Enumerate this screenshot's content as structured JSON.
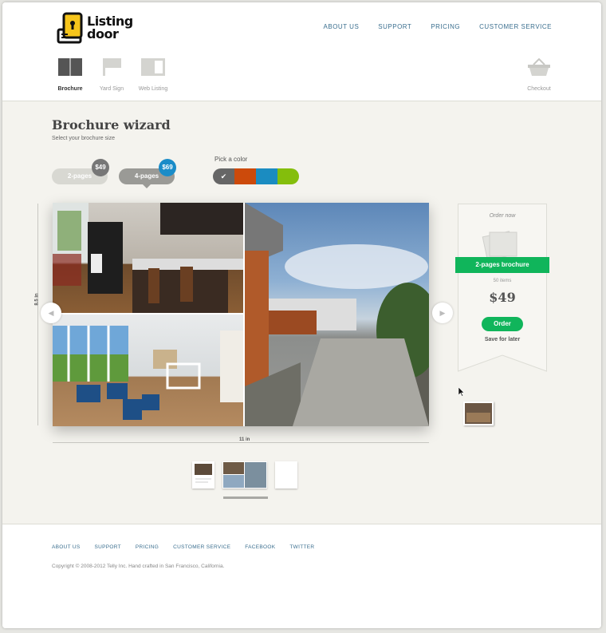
{
  "brand": {
    "name_line1": "Listing",
    "name_line2": "door"
  },
  "topnav": [
    "ABOUT US",
    "SUPPORT",
    "PRICING",
    "CUSTOMER SERVICE"
  ],
  "tools": [
    {
      "label": "Brochure",
      "active": true
    },
    {
      "label": "Yard Sign",
      "active": false
    },
    {
      "label": "Web Listing",
      "active": false
    }
  ],
  "checkout": {
    "label": "Checkout"
  },
  "wizard": {
    "title": "Brochure wizard",
    "subtitle": "Select your brochure size"
  },
  "sizes": [
    {
      "label": "2-pages",
      "price": "$49"
    },
    {
      "label": "4-pages",
      "price": "$69"
    }
  ],
  "color_picker": {
    "label": "Pick a color",
    "colors": [
      "#666666",
      "#cc4a0b",
      "#1b8cc1",
      "#84be0c"
    ],
    "selected": 0
  },
  "dimensions": {
    "height": "8.5 in",
    "width": "11 in"
  },
  "order": {
    "heading": "Order now",
    "product": "2-pages brochure",
    "items": "50 items",
    "price": "$49",
    "button": "Order",
    "save": "Save for later"
  },
  "footer": {
    "links": [
      "ABOUT US",
      "SUPPORT",
      "PRICING",
      "CUSTOMER SERVICE",
      "FACEBOOK",
      "TWITTER"
    ],
    "copyright": "Copyright © 2008-2012 Telly Inc. Hand crafted in San Francisco, California."
  }
}
